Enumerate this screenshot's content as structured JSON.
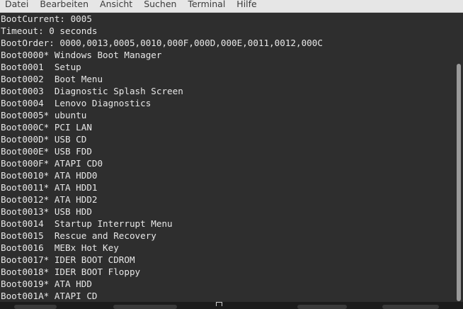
{
  "menubar": {
    "items": [
      "Datei",
      "Bearbeiten",
      "Ansicht",
      "Suchen",
      "Terminal",
      "Hilfe"
    ]
  },
  "terminal": {
    "lines": [
      "BootCurrent: 0005",
      "Timeout: 0 seconds",
      "BootOrder: 0000,0013,0005,0010,000F,000D,000E,0011,0012,000C",
      "Boot0000* Windows Boot Manager",
      "Boot0001  Setup",
      "Boot0002  Boot Menu",
      "Boot0003  Diagnostic Splash Screen",
      "Boot0004  Lenovo Diagnostics",
      "Boot0005* ubuntu",
      "Boot000C* PCI LAN",
      "Boot000D* USB CD",
      "Boot000E* USB FDD",
      "Boot000F* ATAPI CD0",
      "Boot0010* ATA HDD0",
      "Boot0011* ATA HDD1",
      "Boot0012* ATA HDD2",
      "Boot0013* USB HDD",
      "Boot0014  Startup Interrupt Menu",
      "Boot0015  Rescue and Recovery",
      "Boot0016  MEBx Hot Key",
      "Boot0017* IDER BOOT CDROM",
      "Boot0018* IDER BOOT Floppy",
      "Boot0019* ATA HDD",
      "Boot001A* ATAPI CD"
    ]
  },
  "colors": {
    "terminal_bg": "#2e2e2e",
    "terminal_fg": "#e8e8e8",
    "menubar_bg": "#e6e6e6"
  }
}
